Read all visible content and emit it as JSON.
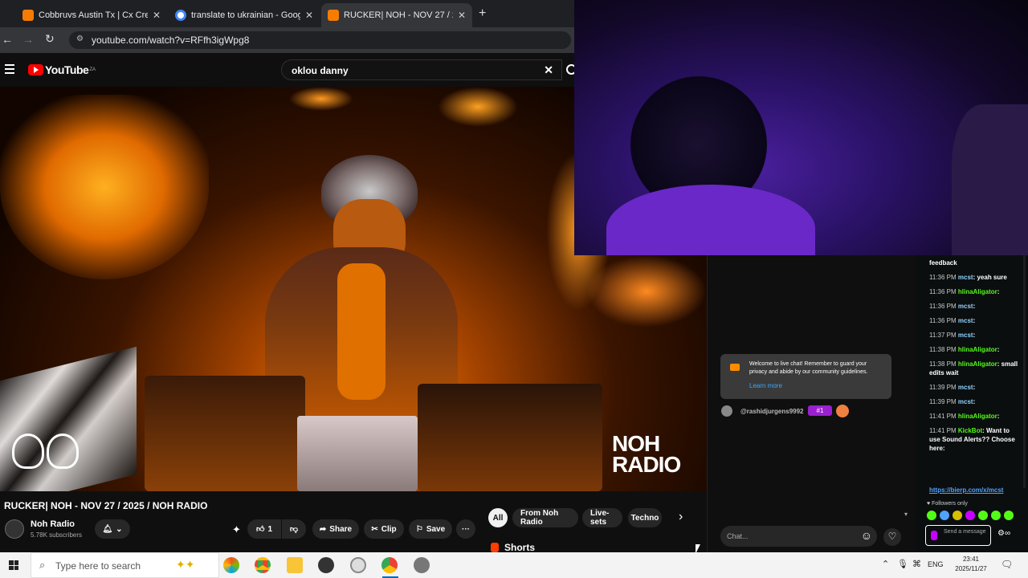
{
  "browser": {
    "tabs": [
      {
        "title": "Cobbruvs Austin Tx | Cx Cre",
        "favicon_color": "#f57c00"
      },
      {
        "title": "translate to ukrainian - Google",
        "favicon_color": "#ffffff"
      },
      {
        "title": "RUCKER| NOH - NOV 27 / 2",
        "favicon_color": "#f57c00"
      }
    ],
    "url": "youtube.com/watch?v=RFfh3igWpg8"
  },
  "youtube": {
    "logo": "YouTube",
    "logo_sup": "ZA",
    "search_value": "oklou danny",
    "video_title": "RUCKER| NOH - NOV 27 / 2025 / NOH RADIO",
    "watermark_line1": "NOH",
    "watermark_line2": "RADIO",
    "channel_name": "Noh Radio",
    "subscribers": "5.78K subscribers",
    "like_count": "1",
    "share_label": "Share",
    "clip_label": "Clip",
    "save_label": "Save",
    "chips": [
      "All",
      "From Noh Radio",
      "Live-sets",
      "Techno"
    ],
    "shorts_label": "Shorts",
    "chat_welcome": "Welcome to live chat! Remember to guard your privacy and abide by our community guidelines.",
    "chat_learn_more": "Learn more",
    "chat_user": "@rashidjurgens9992",
    "chat_badge": "#1",
    "chat_placeholder": "Chat..."
  },
  "kick_chat": {
    "messages": [
      {
        "time": "",
        "user": "",
        "text": "feedback"
      },
      {
        "time": "11:36 PM",
        "user": "mcst",
        "text": "yeah sure"
      },
      {
        "time": "11:36 PM",
        "user": "hlinaAligator",
        "text": ""
      },
      {
        "time": "11:36 PM",
        "user": "mcst",
        "text": ""
      },
      {
        "time": "11:36 PM",
        "user": "mcst",
        "text": ""
      },
      {
        "time": "11:37 PM",
        "user": "mcst",
        "text": ""
      },
      {
        "time": "11:38 PM",
        "user": "hlinaAligator",
        "text": ""
      },
      {
        "time": "11:38 PM",
        "user": "hlinaAligator",
        "text": "small edits wait"
      },
      {
        "time": "11:39 PM",
        "user": "mcst",
        "text": ""
      },
      {
        "time": "11:39 PM",
        "user": "mcst",
        "text": ""
      },
      {
        "time": "11:41 PM",
        "user": "hlinaAligator",
        "text": ""
      },
      {
        "time": "11:41 PM",
        "user": "KickBot",
        "text": "Want to use Sound Alerts?? Choose here:"
      }
    ],
    "link": "https://bierp.com/x/mcst",
    "followers_only": "Followers only",
    "send_placeholder": "Send a message"
  },
  "taskbar": {
    "search_placeholder": "Type here to search",
    "language": "ENG",
    "time": "23:41",
    "date": "2025/11/27"
  },
  "colors": {
    "yt_red": "#ff0000",
    "kick_green": "#53fc18",
    "kick_purple": "#c800ff"
  }
}
